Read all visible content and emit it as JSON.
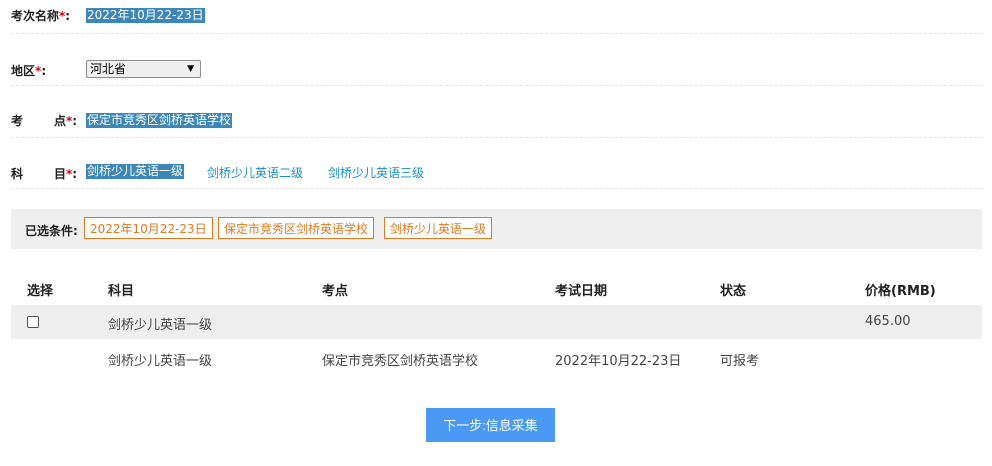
{
  "form": {
    "exam_name": {
      "label": "考次名称",
      "required_mark": "*",
      "colon": ":",
      "value": "2022年10月22-23日"
    },
    "region": {
      "label_a": "地",
      "label_b": "区",
      "required_mark": "*",
      "colon": ":",
      "selected": "河北省"
    },
    "site": {
      "label_a": "考",
      "label_b": "点",
      "required_mark": "*",
      "colon": ":",
      "value": "保定市竞秀区剑桥英语学校"
    },
    "subject": {
      "label_a": "科",
      "label_b": "目",
      "required_mark": "*",
      "colon": ":",
      "options": [
        "剑桥少儿英语一级",
        "剑桥少儿英语二级",
        "剑桥少儿英语三级"
      ],
      "selected_index": 0
    }
  },
  "conditions": {
    "label": "已选条件:",
    "tags": [
      "2022年10月22-23日",
      "保定市竞秀区剑桥英语学校",
      "剑桥少儿英语一级"
    ]
  },
  "table": {
    "headers": [
      "选择",
      "科目",
      "考点",
      "考试日期",
      "状态",
      "价格(RMB)"
    ],
    "group_row": {
      "subject": "剑桥少儿英语一级",
      "price": "465.00",
      "checked": false
    },
    "rows": [
      {
        "subject": "剑桥少儿英语一级",
        "site": "保定市竞秀区剑桥英语学校",
        "date": "2022年10月22-23日",
        "status": "可报考"
      }
    ]
  },
  "next_button": "下一步:信息采集",
  "colors": {
    "selected_bg": "#3b87b9",
    "link": "#1a8fc7",
    "tag": "#e07a1f",
    "button": "#4a9af5",
    "required": "#d9001b"
  }
}
